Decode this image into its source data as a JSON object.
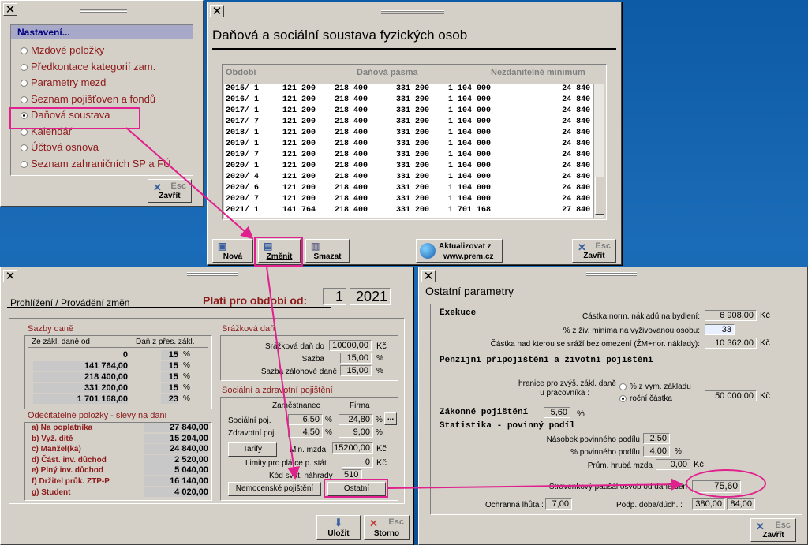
{
  "menu_window": {
    "close_glyph": "✕",
    "title": "Nastavení...",
    "items": [
      {
        "label": "Mzdové položky",
        "selected": false
      },
      {
        "label": "Předkontace kategorií zam.",
        "selected": false
      },
      {
        "label": "Parametry mezd",
        "selected": false
      },
      {
        "label": "Seznam pojišťoven a fondů",
        "selected": false
      },
      {
        "label": "Daňová soustava",
        "selected": true
      },
      {
        "label": "Kalendář",
        "selected": false
      },
      {
        "label": "Účtová osnova",
        "selected": false
      },
      {
        "label": "Seznam zahraničních SP a FÚ",
        "selected": false
      }
    ],
    "close_button": {
      "esc": "Esc",
      "label": "Zavřít"
    }
  },
  "tax_window": {
    "title": "Daňová a sociální soustava fyzických osob",
    "headers": {
      "period": "Období",
      "bands": "Daňová pásma",
      "minimum": "Nezdanitelné minimum"
    },
    "rows": [
      "2015/ 1     121 200    218 400      331 200    1 104 000               24 840",
      "2016/ 1     121 200    218 400      331 200    1 104 000               24 840",
      "2017/ 1     121 200    218 400      331 200    1 104 000               24 840",
      "2017/ 7     121 200    218 400      331 200    1 104 000               24 840",
      "2018/ 1     121 200    218 400      331 200    1 104 000               24 840",
      "2019/ 1     121 200    218 400      331 200    1 104 000               24 840",
      "2019/ 7     121 200    218 400      331 200    1 104 000               24 840",
      "2020/ 1     121 200    218 400      331 200    1 104 000               24 840",
      "2020/ 4     121 200    218 400      331 200    1 104 000               24 840",
      "2020/ 6     121 200    218 400      331 200    1 104 000               24 840",
      "2020/ 7     121 200    218 400      331 200    1 104 000               24 840",
      "2021/ 1     141 764    218 400      331 200    1 701 168               27 840"
    ],
    "buttons": {
      "new": "Nová",
      "change": "Změnit",
      "delete": "Smazat",
      "update_line1": "Aktualizovat z",
      "update_line2": "www.prem.cz",
      "esc": "Esc",
      "close": "Zavřít"
    }
  },
  "edit_window": {
    "title": "Prohlížení / Provádění změn",
    "valid_label": "Platí pro období od:",
    "valid_month": "1",
    "valid_year": "2021",
    "tax_rates": {
      "title": "Sazby daně",
      "col_from": "Ze zákl. daně od",
      "col_rate": "Daň z přes. zákl.",
      "rows": [
        {
          "from": "0",
          "rate": "15"
        },
        {
          "from": "141 764,00",
          "rate": "15"
        },
        {
          "from": "218 400,00",
          "rate": "15"
        },
        {
          "from": "331 200,00",
          "rate": "15"
        },
        {
          "from": "1 701 168,00",
          "rate": "23"
        }
      ],
      "pct": "%"
    },
    "deductions": {
      "title": "Odečitatelné položky - slevy na dani",
      "rows": [
        {
          "label": "a) Na poplatníka",
          "value": "27 840,00"
        },
        {
          "label": "b) Vyž. dítě",
          "value": "15 204,00"
        },
        {
          "label": "c) Manžel(ka)",
          "value": "24 840,00"
        },
        {
          "label": "d) Část. inv. důchod",
          "value": "2 520,00"
        },
        {
          "label": "e) Plný inv. důchod",
          "value": "5 040,00"
        },
        {
          "label": "f) Držitel průk. ZTP-P",
          "value": "16 140,00"
        },
        {
          "label": "g) Student",
          "value": "4 020,00"
        }
      ]
    },
    "withholding": {
      "title": "Srážková daň",
      "limit_label": "Srážková daň do",
      "limit_value": "10000,00",
      "limit_unit": "Kč",
      "rate_label": "Sazba",
      "rate_value": "15,00",
      "advance_label": "Sazba zálohové daně",
      "advance_value": "15,00",
      "pct": "%"
    },
    "insurance": {
      "title": "Sociální a zdravotní pojištění",
      "col_employee": "Zaměstnanec",
      "col_company": "Firma",
      "social_label": "Sociální poj.",
      "social_employee": "6,50",
      "social_company": "24,80",
      "health_label": "Zdravotní poj.",
      "health_employee": "4,50",
      "health_company": "9,00",
      "pct": "%",
      "more": "...",
      "tariffs": "Tarify",
      "min_wage_label": "Min. mzda",
      "min_wage_value": "15200,00",
      "unit": "Kč",
      "limits_label": "Limity pro plátce p. stát",
      "limits_value": "0",
      "holiday_label": "Kód svát. náhrady",
      "holiday_value": "510",
      "sickness_button": "Nemocenské pojištění",
      "other_button": "Ostatní"
    },
    "save": "Uložit",
    "esc": "Esc",
    "cancel": "Storno"
  },
  "other_window": {
    "title": "Ostatní parametry",
    "expenses_section": "Exekuce",
    "housing_label": "Částka norm. nákladů na bydlení:",
    "housing_value": "6 908,00",
    "unit": "Kč",
    "minimum_label": "% z živ. minima na vyživovanou osobu:",
    "minimum_value": "33",
    "unseized_label": "Částka nad kterou se sráží bez omezení (ŽM+nor. náklady):",
    "unseized_value": "10 362,00",
    "pension_section": "Penzijní připojištění a životní pojištění",
    "limit_label1": "hranice pro zvýš. zákl. daně",
    "limit_label2": "u pracovníka :",
    "opt_percent": "% z vym. základu",
    "opt_annual": "roční částka",
    "limit_value": "50 000,00",
    "statutory_label": "Zákonné pojištění",
    "statutory_value": "5,60",
    "pct": "%",
    "stats_section": "Statistika - povinný podíl",
    "multiple_label": "Násobek povinného podílu",
    "multiple_value": "2,50",
    "share_label": "% povinného podílu",
    "share_value": "4,00",
    "avg_wage_label": "Prům. hrubá mzda",
    "avg_wage_value": "0,00",
    "meal_label": "Stravenkový paušál osvob od daně/den",
    "meal_value": "75,60",
    "protect_label": "Ochranná lhůta :",
    "protect_value": "7,00",
    "support_label": "Podp. doba/dúch. :",
    "support_value1": "380,00",
    "support_value2": "84,00",
    "esc": "Esc",
    "close": "Zavřít"
  },
  "colors": {
    "accent": "#e0208c",
    "section_red": "#8b1a1a",
    "menu_title_blue": "#00007f",
    "desktop": "#1b6cb8"
  }
}
